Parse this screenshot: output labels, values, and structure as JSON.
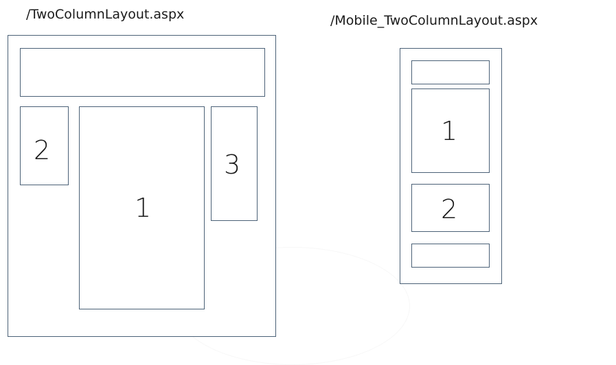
{
  "desktop": {
    "title": "/TwoColumnLayout.aspx",
    "regions": [
      {
        "label": "2"
      },
      {
        "label": "1"
      },
      {
        "label": "3"
      }
    ]
  },
  "mobile": {
    "title": "/Mobile_TwoColumnLayout.aspx",
    "regions": [
      {
        "label": "1"
      },
      {
        "label": "2"
      }
    ]
  },
  "colors": {
    "stroke": "#4a6076",
    "text": "#1a1a1a",
    "background": "#ffffff"
  }
}
